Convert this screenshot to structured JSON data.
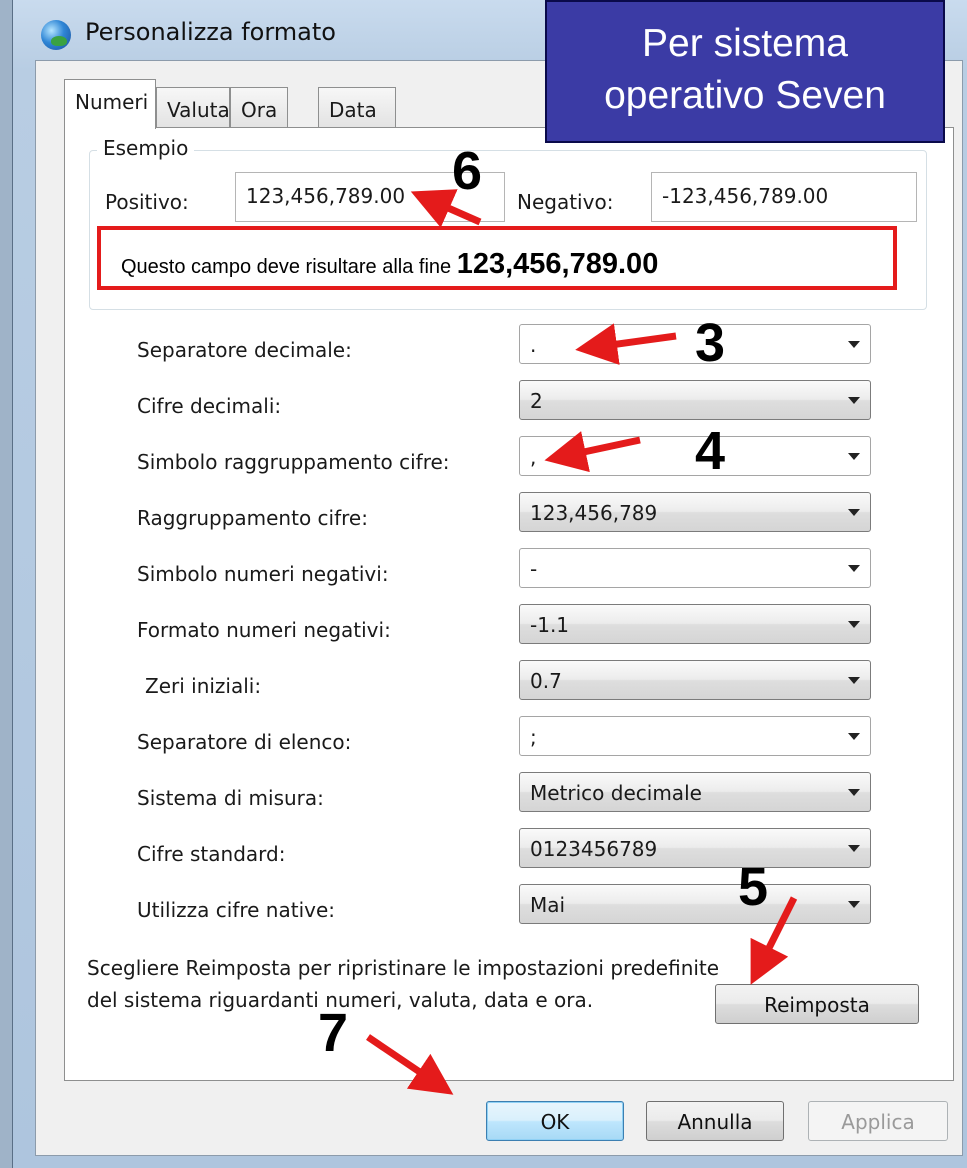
{
  "window": {
    "title": "Personalizza formato"
  },
  "banner": {
    "line1": "Per sistema",
    "line2": "operativo Seven"
  },
  "tabs": [
    {
      "label": "Numeri",
      "active": true
    },
    {
      "label": "Valuta"
    },
    {
      "label": "Ora"
    },
    {
      "label": "Data"
    }
  ],
  "example": {
    "legend": "Esempio",
    "positive_label": "Positivo:",
    "positive_value": "123,456,789.00",
    "negative_label": "Negativo:",
    "negative_value": "-123,456,789.00"
  },
  "callout": {
    "text": "Questo campo deve risultare alla fine ",
    "value": "123,456,789.00"
  },
  "settings": [
    {
      "label": "Separatore decimale:",
      "value": ".",
      "style": "edit"
    },
    {
      "label": "Cifre decimali:",
      "value": "2",
      "style": "list"
    },
    {
      "label": "Simbolo raggruppamento cifre:",
      "value": ",",
      "style": "edit"
    },
    {
      "label": "Raggruppamento cifre:",
      "value": "123,456,789",
      "style": "list"
    },
    {
      "label": "Simbolo numeri negativi:",
      "value": "-",
      "style": "edit"
    },
    {
      "label": "Formato numeri negativi:",
      "value": "-1.1",
      "style": "list"
    },
    {
      "label": "Zeri iniziali:",
      "value": "0.7",
      "style": "list"
    },
    {
      "label": "Separatore di elenco:",
      "value": ";",
      "style": "edit"
    },
    {
      "label": "Sistema di misura:",
      "value": "Metrico decimale",
      "style": "list"
    },
    {
      "label": "Cifre standard:",
      "value": "0123456789",
      "style": "list"
    },
    {
      "label": "Utilizza cifre native:",
      "value": "Mai",
      "style": "list"
    }
  ],
  "reset_note": "Scegliere Reimposta per ripristinare le impostazioni predefinite del sistema riguardanti numeri, valuta, data e ora.",
  "buttons": {
    "reset": "Reimposta",
    "ok": "OK",
    "cancel": "Annulla",
    "apply": "Applica"
  },
  "markers": {
    "m3": "3",
    "m4": "4",
    "m5": "5",
    "m6": "6",
    "m7": "7"
  },
  "colors": {
    "annotation": "#e41b1b",
    "banner": "#3b3ba5"
  }
}
